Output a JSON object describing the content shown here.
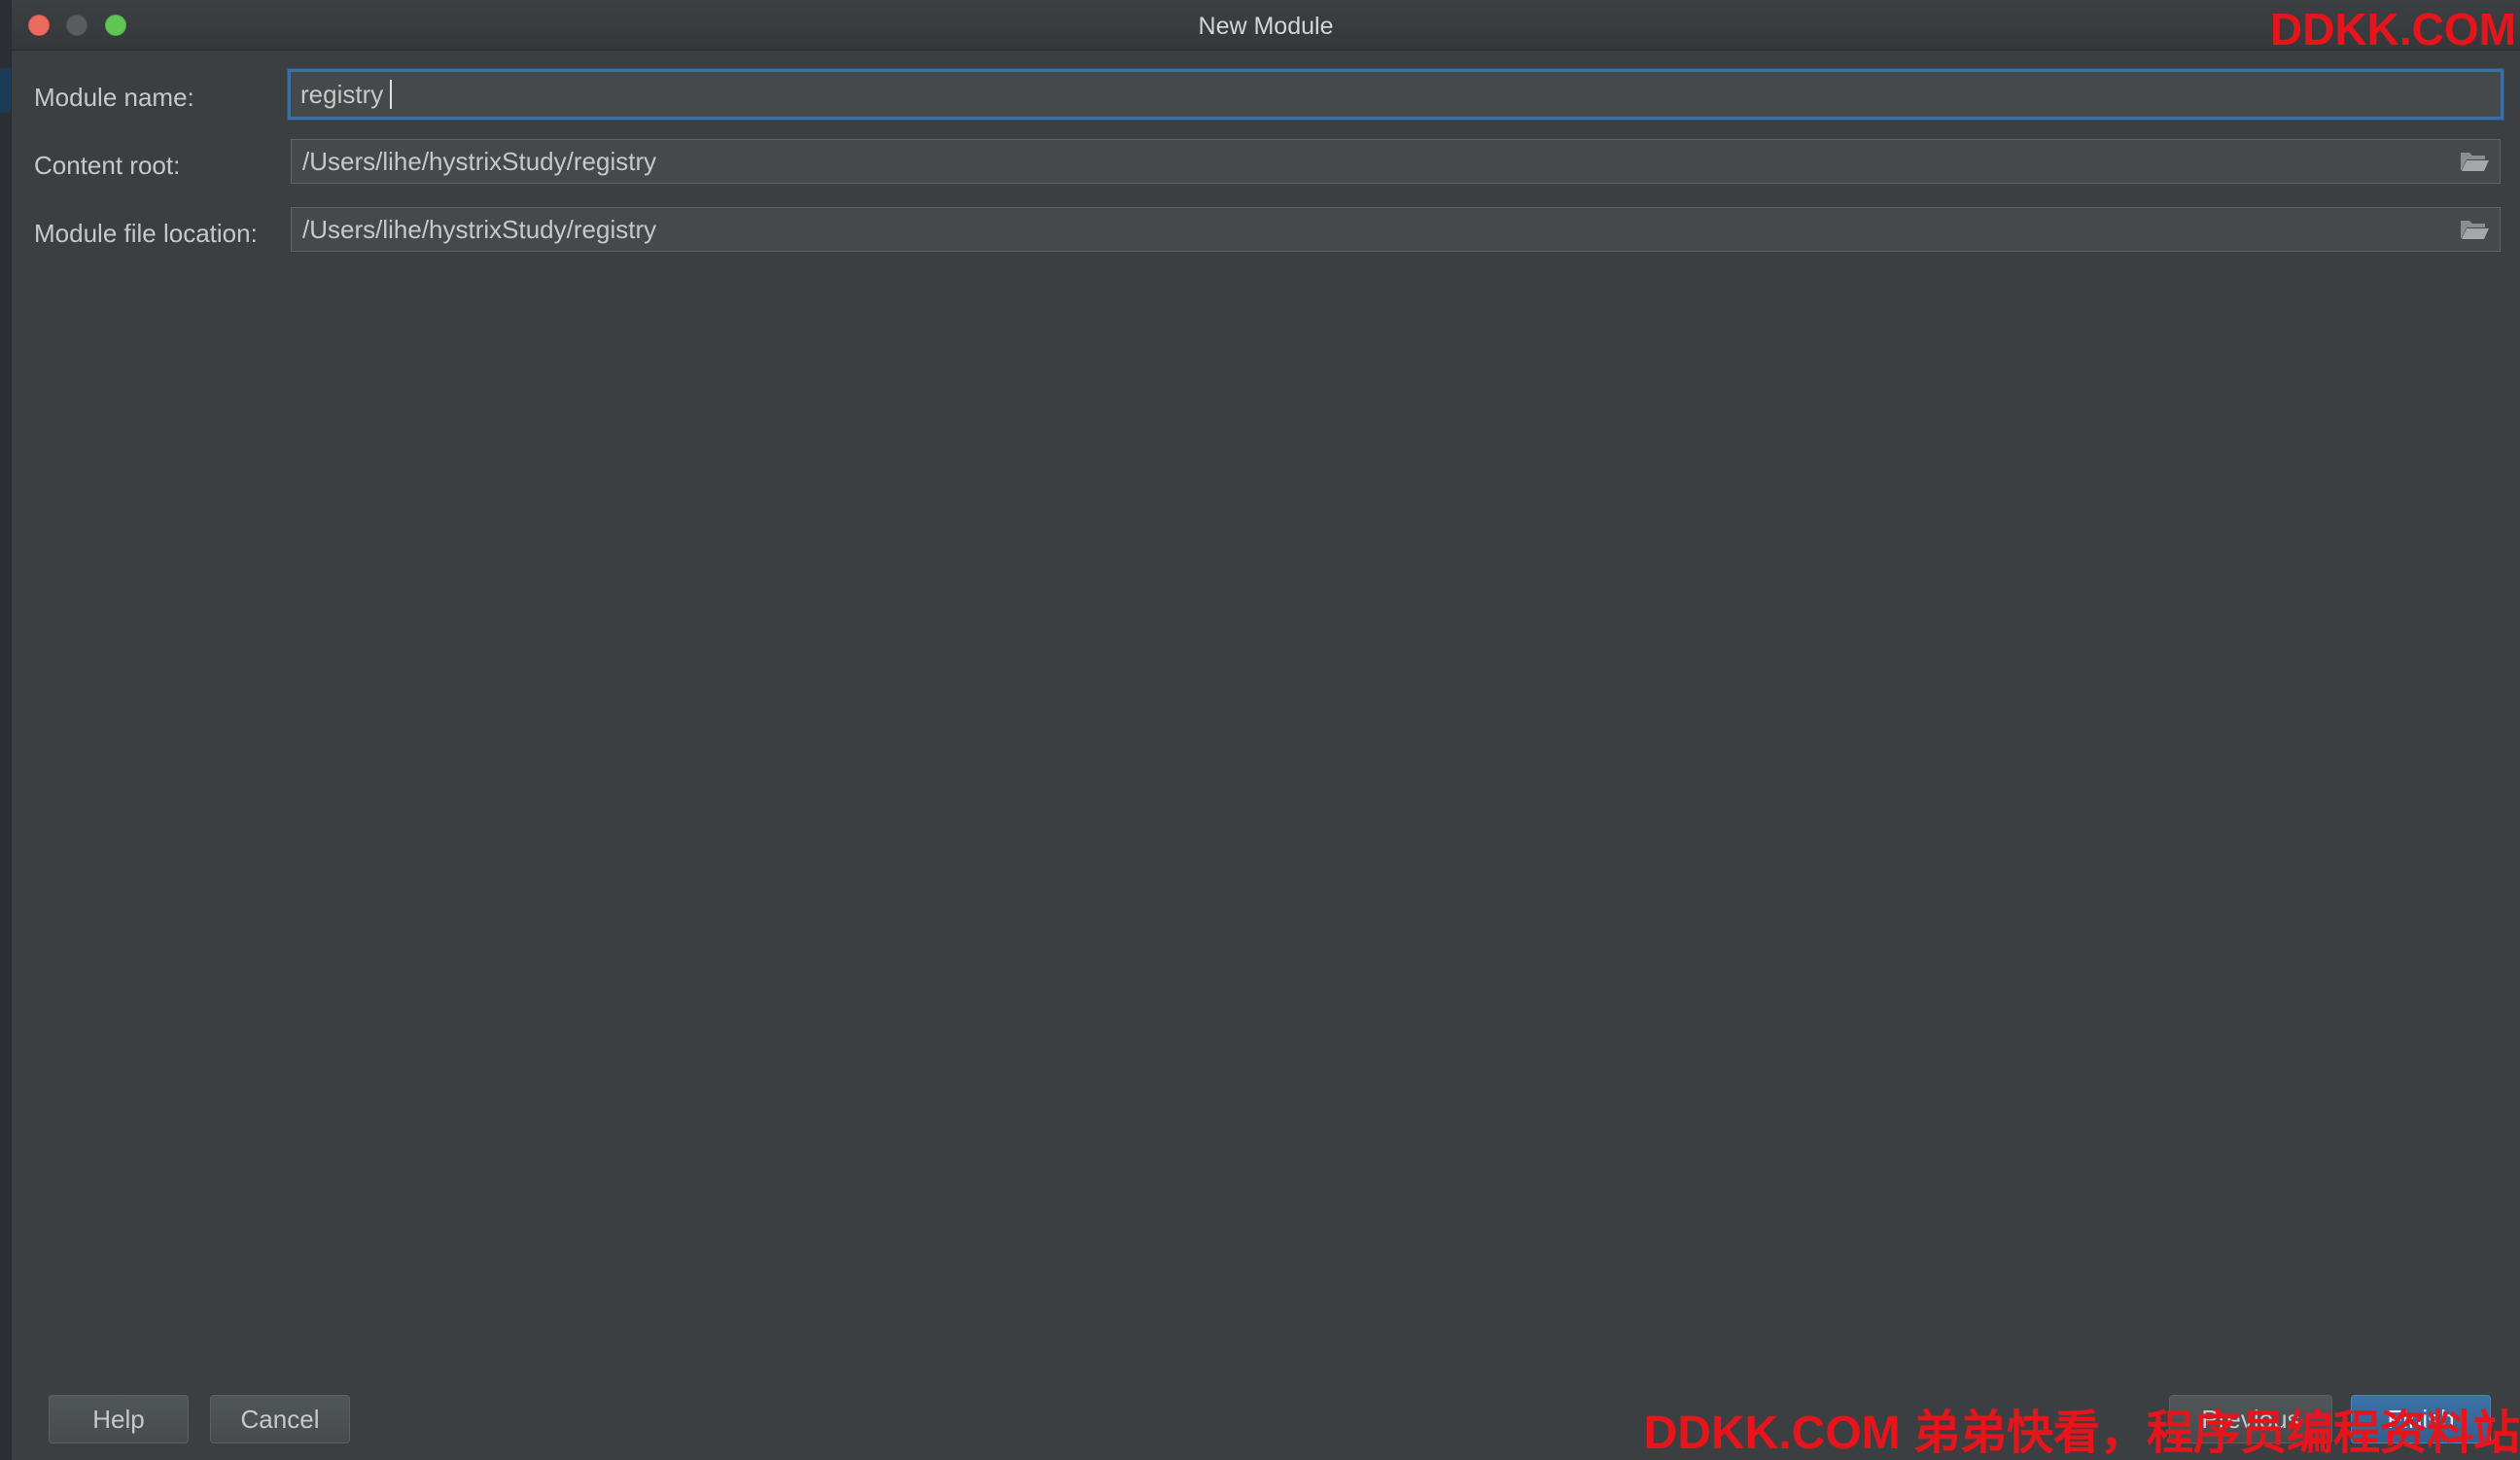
{
  "window": {
    "title": "New Module"
  },
  "form": {
    "module_name": {
      "label": "Module name:",
      "value": "registry"
    },
    "content_root": {
      "label": "Content root:",
      "value": "/Users/lihe/hystrixStudy/registry"
    },
    "module_file_location": {
      "label": "Module file location:",
      "value": "/Users/lihe/hystrixStudy/registry"
    }
  },
  "buttons": {
    "help": "Help",
    "cancel": "Cancel",
    "previous": "Previous",
    "finish": "Finish"
  },
  "watermarks": {
    "top": "DDKK.COM",
    "bottom": "DDKK.COM 弟弟快看，程序员编程资料站"
  },
  "colors": {
    "background": "#3c3f41",
    "field_background": "#45494a",
    "focus_border": "#3d6fa5",
    "watermark": "#e8141b",
    "finish_button": "#365880"
  },
  "icons": {
    "browse": "folder-open-icon"
  }
}
